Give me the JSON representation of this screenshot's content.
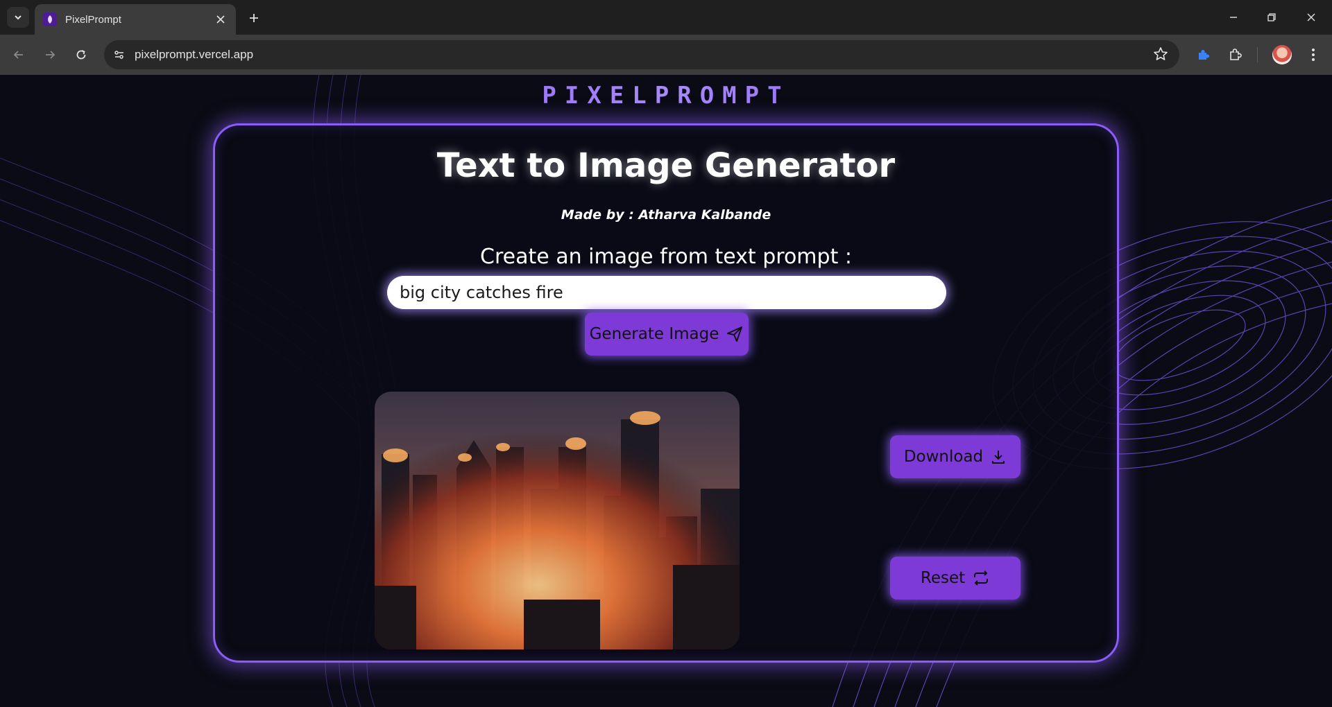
{
  "browser": {
    "tab_title": "PixelPrompt",
    "url": "pixelprompt.vercel.app"
  },
  "page": {
    "logo": "PIXELPROMPT",
    "heading": "Text to Image Generator",
    "credit": "Made by : Atharva Kalbande",
    "prompt_label": "Create an image from text prompt :",
    "prompt_value": "big city catches fire",
    "generate_label": "Generate Image",
    "download_label": "Download",
    "reset_label": "Reset"
  },
  "colors": {
    "accent": "#8b5cf6",
    "button": "#7e3ad6",
    "background": "#0a0b14"
  }
}
